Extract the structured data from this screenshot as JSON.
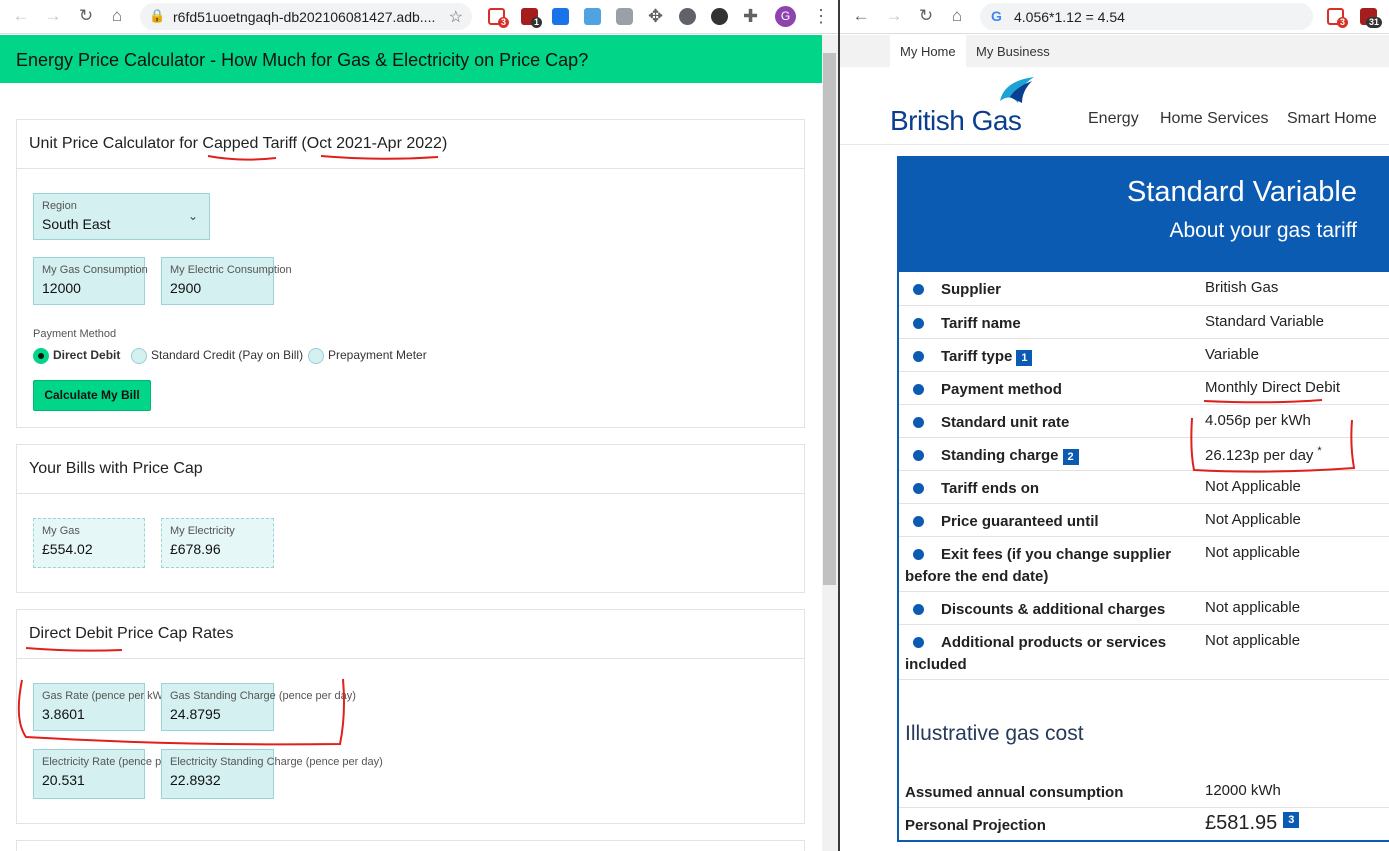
{
  "left": {
    "url": "r6fd51uoetngaqh-db202106081427.adb....",
    "extension_badges": [
      "3",
      "1"
    ],
    "profile_initial": "G",
    "banner": "Energy Price Calculator - How Much for Gas & Electricity on Price Cap?",
    "calc_card": {
      "title": "Unit Price Calculator for Capped Tariff (Oct 2021-Apr 2022)",
      "region_label": "Region",
      "region_value": "South East",
      "gas_label": "My Gas Consumption",
      "gas_value": "12000",
      "elec_label": "My Electric Consumption",
      "elec_value": "2900",
      "payment_label": "Payment Method",
      "payment_options": [
        "Direct Debit",
        "Standard Credit (Pay on Bill)",
        "Prepayment Meter"
      ],
      "selected_payment": "Direct Debit",
      "button": "Calculate My Bill"
    },
    "bills_card": {
      "title": "Your Bills with Price Cap",
      "gas_label": "My Gas",
      "gas_value": "£554.02",
      "elec_label": "My Electricity",
      "elec_value": "£678.96"
    },
    "rates_card": {
      "title": "Direct Debit Price Cap Rates",
      "gas_rate_label": "Gas Rate (pence per kWh)",
      "gas_rate_value": "3.8601",
      "gas_sc_label": "Gas Standing Charge (pence per day)",
      "gas_sc_value": "24.8795",
      "elec_rate_label": "Electricity Rate (pence per kWh)",
      "elec_rate_value": "20.531",
      "elec_sc_label": "Electricity Standing Charge (pence per day)",
      "elec_sc_value": "22.8932"
    }
  },
  "right": {
    "omnibox": "4.056*1.12 = 4.54",
    "extension_badges": [
      "3",
      "31"
    ],
    "tabs": [
      "My Home",
      "My Business"
    ],
    "logo": "British Gas",
    "nav": [
      "Energy",
      "Home Services",
      "Smart Home"
    ],
    "heading": "Standard Variable",
    "subheading": "About your gas tariff",
    "rows": [
      {
        "k": "Supplier",
        "v": "British Gas"
      },
      {
        "k": "Tariff name",
        "v": "Standard Variable"
      },
      {
        "k": "Tariff type",
        "v": "Variable",
        "info": "1"
      },
      {
        "k": "Payment method",
        "v": "Monthly Direct Debit"
      },
      {
        "k": "Standard unit rate",
        "v": "4.056p per kWh"
      },
      {
        "k": "Standing charge",
        "v": "26.123p per day",
        "info": "2",
        "note": "*"
      },
      {
        "k": "Tariff ends on",
        "v": "Not Applicable"
      },
      {
        "k": "Price guaranteed until",
        "v": "Not Applicable"
      },
      {
        "k": "Exit fees (if you change supplier before the end date)",
        "v": "Not applicable"
      },
      {
        "k": "Discounts & additional charges",
        "v": "Not applicable"
      },
      {
        "k": "Additional products or services included",
        "v": "Not applicable"
      }
    ],
    "section": "Illustrative gas cost",
    "assumed_label": "Assumed annual consumption",
    "assumed_value": "12000 kWh",
    "projection_label": "Personal Projection",
    "projection_value": "£581.95",
    "projection_info": "3"
  },
  "colors": {
    "accent_green": "#00d588",
    "bg_blue": "#0c5bb3",
    "annotation_red": "#e0201b"
  }
}
